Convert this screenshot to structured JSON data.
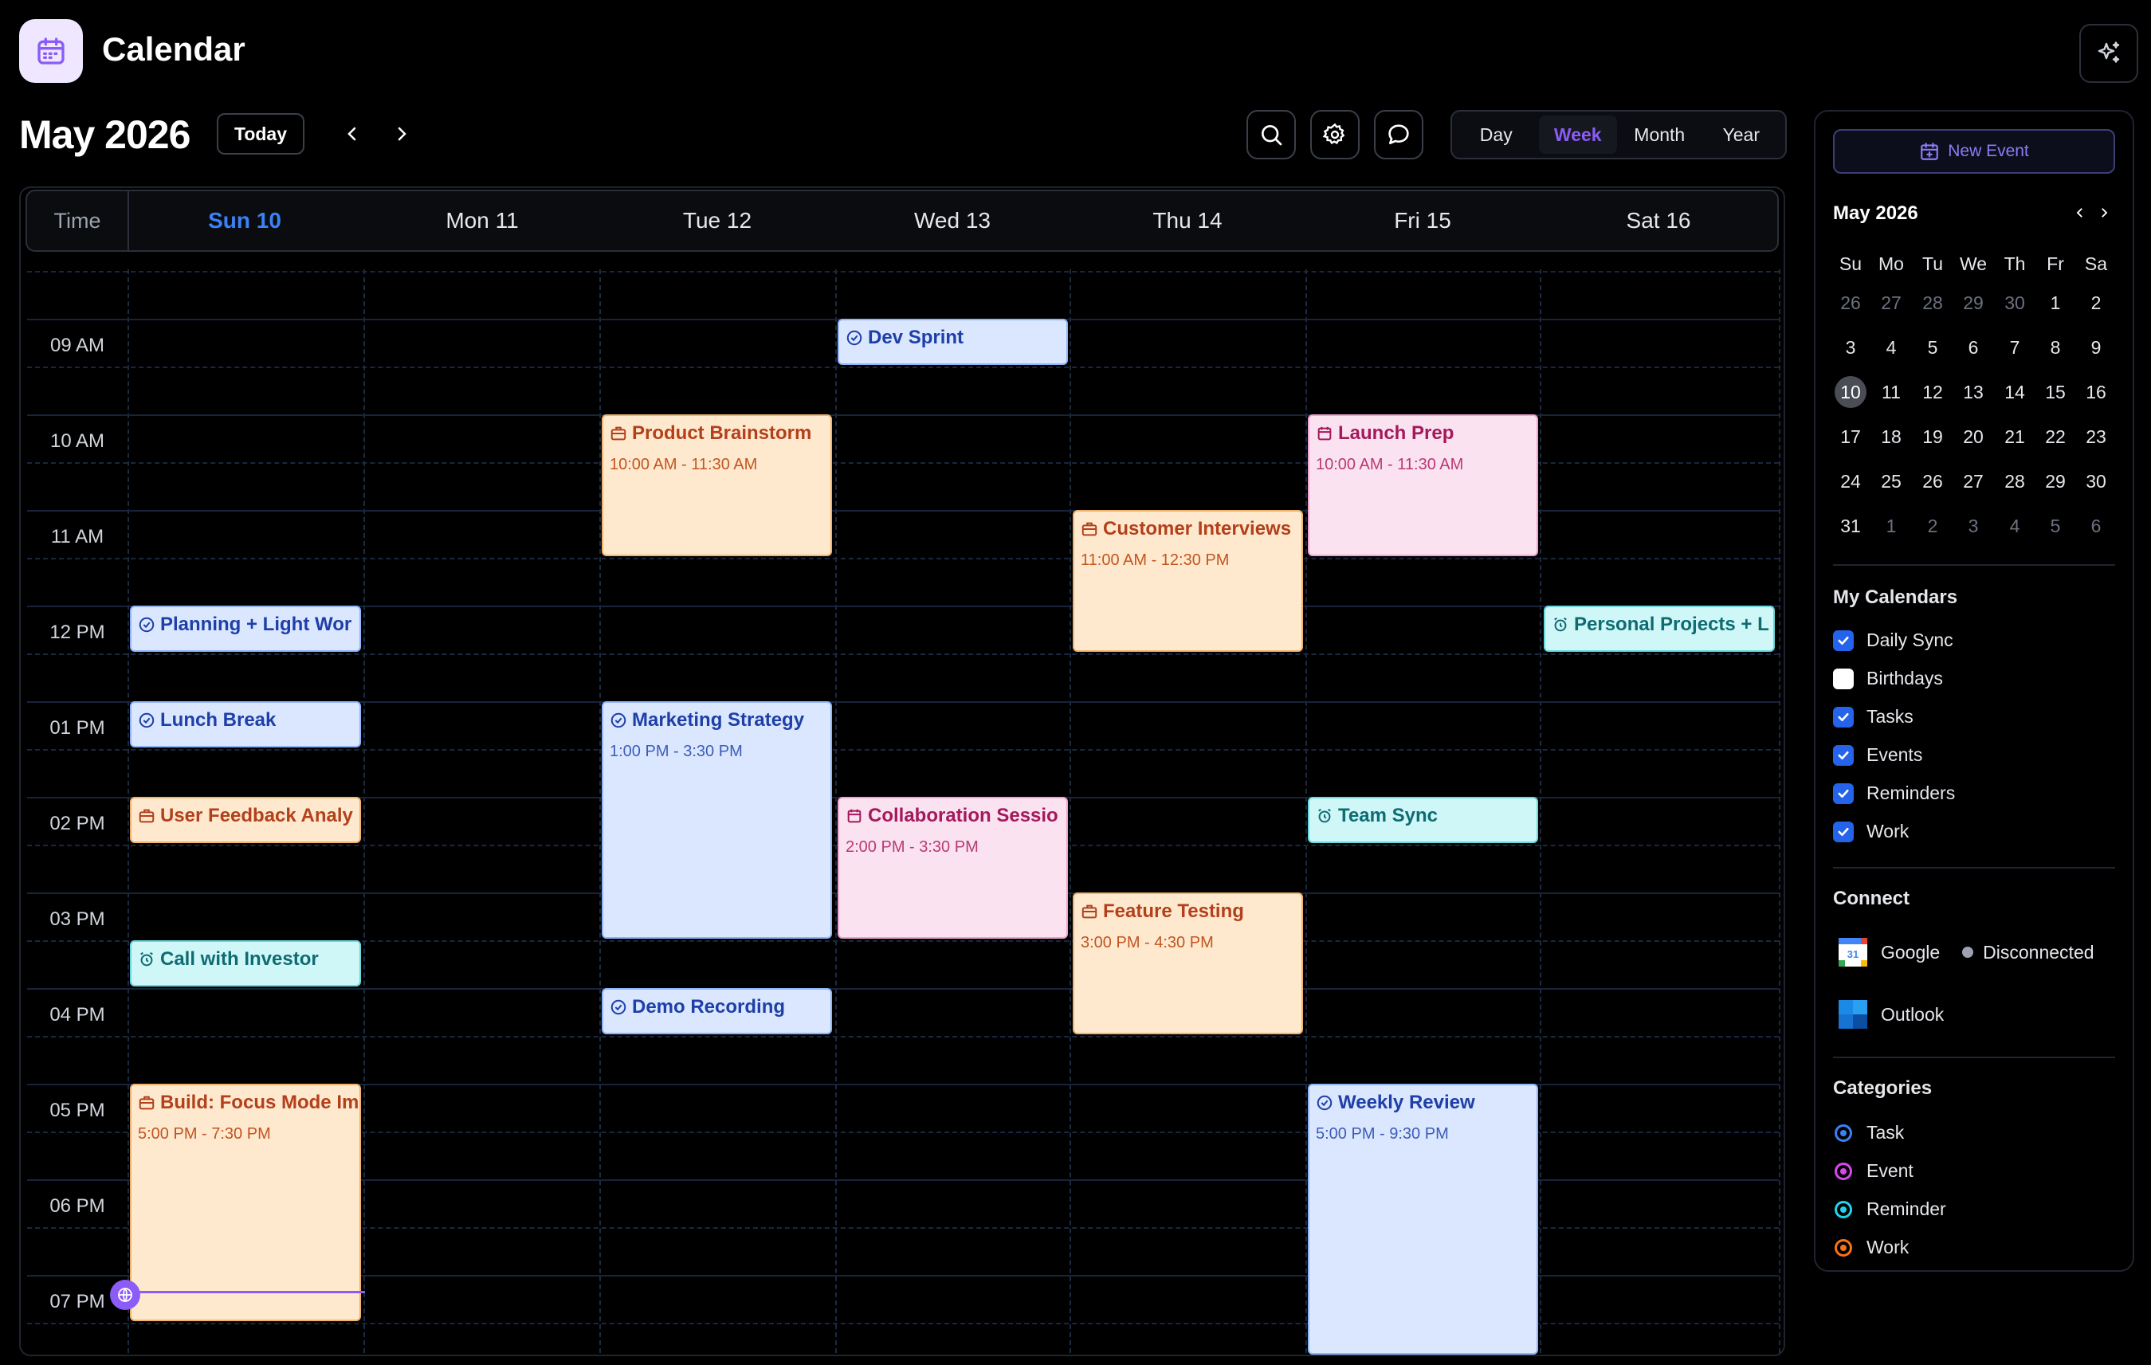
{
  "app": {
    "title": "Calendar"
  },
  "toolbar": {
    "month_title": "May 2026",
    "today_label": "Today",
    "views": [
      "Day",
      "Week",
      "Month",
      "Year"
    ],
    "active_view": "Week"
  },
  "grid": {
    "time_header": "Time",
    "days": [
      "Sun 10",
      "Mon 11",
      "Tue 12",
      "Wed 13",
      "Thu 14",
      "Fri 15",
      "Sat 16"
    ],
    "today_index": 0,
    "hours": [
      "09 AM",
      "10 AM",
      "11 AM",
      "12 PM",
      "01 PM",
      "02 PM",
      "03 PM",
      "04 PM",
      "05 PM",
      "06 PM",
      "07 PM"
    ]
  },
  "events": [
    {
      "title": "Dev Sprint",
      "time": "",
      "category": "task",
      "icon": "check-circle-icon"
    },
    {
      "title": "Product Brainstorm",
      "time": "10:00 AM - 11:30 AM",
      "category": "work",
      "icon": "briefcase-icon"
    },
    {
      "title": "Launch Prep",
      "time": "10:00 AM - 11:30 AM",
      "category": "event",
      "icon": "calendar-icon"
    },
    {
      "title": "Customer Interviews",
      "time": "11:00 AM - 12:30 PM",
      "category": "work",
      "icon": "briefcase-icon"
    },
    {
      "title": "Planning + Light Wor",
      "time": "",
      "category": "task",
      "icon": "check-circle-icon"
    },
    {
      "title": "Personal Projects + L",
      "time": "",
      "category": "reminder",
      "icon": "alarm-icon"
    },
    {
      "title": "Lunch Break",
      "time": "",
      "category": "task",
      "icon": "check-circle-icon"
    },
    {
      "title": "Marketing Strategy",
      "time": "1:00 PM - 3:30 PM",
      "category": "task",
      "icon": "check-circle-icon"
    },
    {
      "title": "User Feedback Analy",
      "time": "",
      "category": "work",
      "icon": "briefcase-icon"
    },
    {
      "title": "Collaboration Sessio",
      "time": "2:00 PM - 3:30 PM",
      "category": "event",
      "icon": "calendar-icon"
    },
    {
      "title": "Team Sync",
      "time": "",
      "category": "reminder",
      "icon": "alarm-icon"
    },
    {
      "title": "Feature Testing",
      "time": "3:00 PM - 4:30 PM",
      "category": "work",
      "icon": "briefcase-icon"
    },
    {
      "title": "Call with Investor",
      "time": "",
      "category": "reminder",
      "icon": "alarm-icon"
    },
    {
      "title": "Demo Recording",
      "time": "",
      "category": "task",
      "icon": "check-circle-icon"
    },
    {
      "title": "Build: Focus Mode Im",
      "time": "5:00 PM - 7:30 PM",
      "category": "work",
      "icon": "briefcase-icon"
    },
    {
      "title": "Weekly Review",
      "time": "5:00 PM - 9:30 PM",
      "category": "task",
      "icon": "check-circle-icon"
    }
  ],
  "sidebar": {
    "new_event_label": "New Event",
    "mini_calendar": {
      "title": "May 2026",
      "weekdays": [
        "Su",
        "Mo",
        "Tu",
        "We",
        "Th",
        "Fr",
        "Sa"
      ],
      "weeks": [
        [
          "26",
          "27",
          "28",
          "29",
          "30",
          "1",
          "2"
        ],
        [
          "3",
          "4",
          "5",
          "6",
          "7",
          "8",
          "9"
        ],
        [
          "10",
          "11",
          "12",
          "13",
          "14",
          "15",
          "16"
        ],
        [
          "17",
          "18",
          "19",
          "20",
          "21",
          "22",
          "23"
        ],
        [
          "24",
          "25",
          "26",
          "27",
          "28",
          "29",
          "30"
        ],
        [
          "31",
          "1",
          "2",
          "3",
          "4",
          "5",
          "6"
        ]
      ],
      "selected": "10"
    },
    "my_calendars": {
      "title": "My Calendars",
      "items": [
        {
          "label": "Daily Sync",
          "checked": true
        },
        {
          "label": "Birthdays",
          "checked": false
        },
        {
          "label": "Tasks",
          "checked": true
        },
        {
          "label": "Events",
          "checked": true
        },
        {
          "label": "Reminders",
          "checked": true
        },
        {
          "label": "Work",
          "checked": true
        }
      ]
    },
    "connect": {
      "title": "Connect",
      "items": [
        {
          "label": "Google",
          "status": "Disconnected",
          "icon": "google-calendar-icon"
        },
        {
          "label": "Outlook",
          "status": "",
          "icon": "outlook-icon"
        }
      ]
    },
    "categories": {
      "title": "Categories",
      "items": [
        {
          "label": "Task",
          "color": "#3b82f6"
        },
        {
          "label": "Event",
          "color": "#d946ef"
        },
        {
          "label": "Reminder",
          "color": "#22d3ee"
        },
        {
          "label": "Work",
          "color": "#f97316"
        }
      ]
    }
  },
  "colors": {
    "accent": "#8b5cf6",
    "today": "#3b82f6",
    "task": "#dbe7fe",
    "work": "#fee9cf",
    "event": "#fbe2f0",
    "reminder": "#cff7f7"
  }
}
